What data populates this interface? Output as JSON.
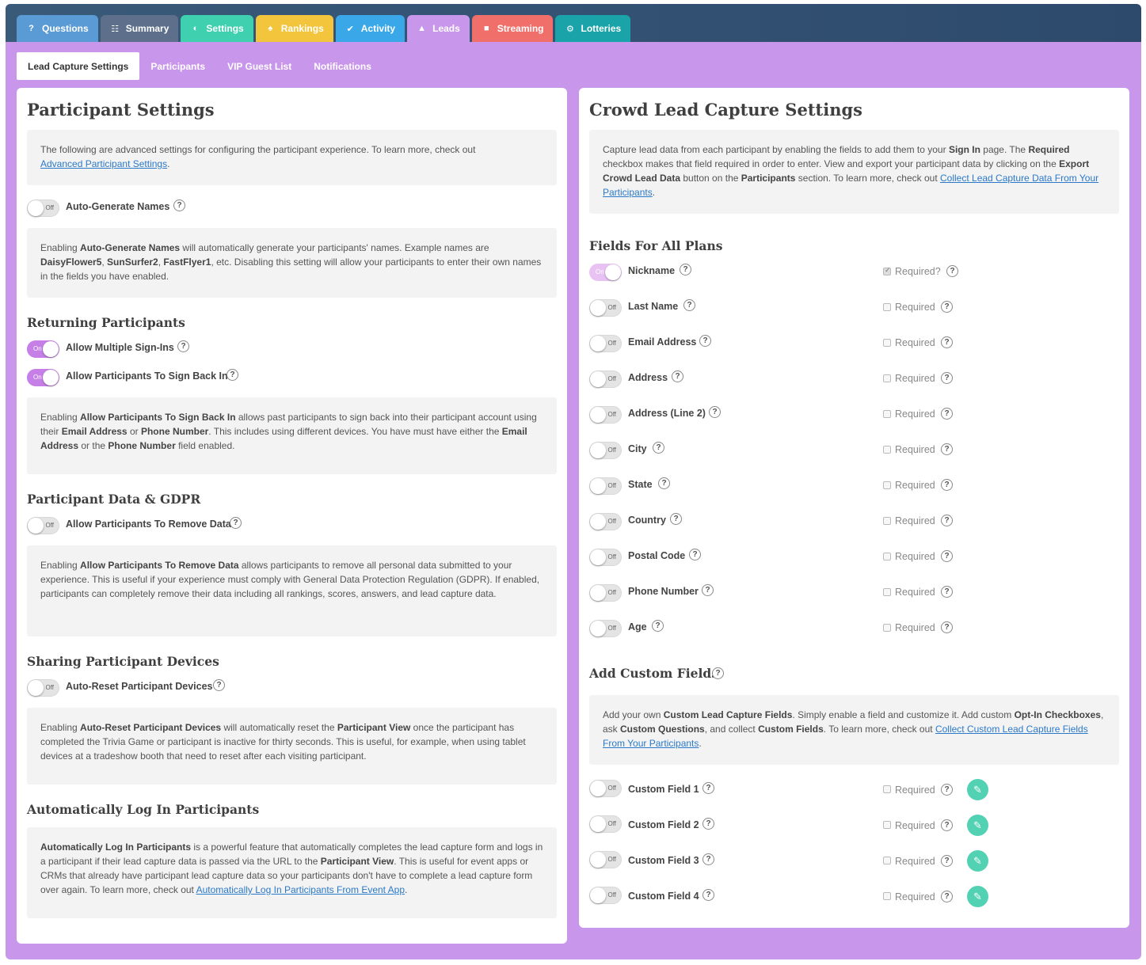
{
  "tabs": [
    {
      "label": "Questions",
      "icon": "question-icon",
      "color": "#5b9bd5"
    },
    {
      "label": "Summary",
      "icon": "list-icon",
      "color": "#5d6f8a"
    },
    {
      "label": "Settings",
      "icon": "toggle-icon",
      "color": "#3fd0b0"
    },
    {
      "label": "Rankings",
      "icon": "trophy-icon",
      "color": "#f2c53d"
    },
    {
      "label": "Activity",
      "icon": "check-circle-icon",
      "color": "#3aa8e8"
    },
    {
      "label": "Leads",
      "icon": "user-icon",
      "color": "#c896ea"
    },
    {
      "label": "Streaming",
      "icon": "video-icon",
      "color": "#f06f6a"
    },
    {
      "label": "Lotteries",
      "icon": "gear-icon",
      "color": "#1aa3a8"
    }
  ],
  "subtabs": [
    "Lead Capture Settings",
    "Participants",
    "VIP Guest List",
    "Notifications"
  ],
  "left": {
    "title": "Participant Settings",
    "intro": {
      "text": "The following are advanced settings for configuring the participant experience. To learn more, check out",
      "link": "Advanced Participant Settings"
    },
    "auto_generate": {
      "label": "Auto-Generate Names",
      "state": "Off"
    },
    "auto_generate_note": {
      "p1": "Enabling ",
      "b1": "Auto-Generate Names",
      "p2": " will automatically generate your participants' names. Example names are ",
      "b2": "DaisyFlower5",
      "p3": ", ",
      "b3": "SunSurfer2",
      "p4": ", ",
      "b4": "FastFlyer1",
      "p5": ", etc. Disabling this setting will allow your participants to enter their own names in the fields you have enabled."
    },
    "returning_title": "Returning Participants",
    "multiple_signins": {
      "label": "Allow Multiple Sign-Ins",
      "state": "On"
    },
    "sign_back_in": {
      "label": "Allow Participants To Sign Back In",
      "state": "On"
    },
    "sign_back_note": {
      "p1": "Enabling ",
      "b1": "Allow Participants To Sign Back In",
      "p2": " allows past participants to sign back into their participant account using their ",
      "b2": "Email Address",
      "p3": " or ",
      "b3": "Phone Number",
      "p4": ". This includes using different devices. You have must have either the ",
      "b4": "Email Address",
      "p5": " or the ",
      "b5": "Phone Number",
      "p6": " field enabled."
    },
    "gdpr_title": "Participant Data & GDPR",
    "remove_data": {
      "label": "Allow Participants To Remove Data",
      "state": "Off"
    },
    "remove_note": {
      "p1": "Enabling ",
      "b1": "Allow Participants To Remove Data",
      "p2": " allows participants to remove all personal data submitted to your experience. This is useful if your experience must comply with General Data Protection Regulation (GDPR). If enabled, participants can completely remove their data including all rankings, scores, answers, and lead capture data."
    },
    "sharing_title": "Sharing Participant Devices",
    "auto_reset": {
      "label": "Auto-Reset Participant Devices",
      "state": "Off"
    },
    "reset_note": {
      "p1": "Enabling ",
      "b1": "Auto-Reset Participant Devices",
      "p2": " will automatically reset the ",
      "b2": "Participant View",
      "p3": " once the participant has completed the Trivia Game or participant is inactive for thirty seconds. This is useful, for example, when using tablet devices at a tradeshow booth that need to reset after each visiting participant."
    },
    "autolog_title": "Automatically Log In Participants",
    "autolog_note": {
      "b1": "Automatically Log In Participants",
      "p1": " is a powerful feature that automatically completes the lead capture form and logs in a participant if their lead capture data is passed via the URL to the ",
      "b2": "Participant View",
      "p2": ". This is useful for event apps or CRMs that already have participant lead capture data so your participants don't have to complete a lead capture form over again. To learn more, check out ",
      "link": "Automatically Log In Participants From Event App"
    }
  },
  "right": {
    "title": "Crowd Lead Capture Settings",
    "intro": {
      "p1": "Capture lead data from each participant by enabling the fields to add them to your ",
      "b1": "Sign In",
      "p2": " page. The ",
      "b2": "Required",
      "p3": " checkbox makes that field required in order to enter. View and export your participant data by clicking on the ",
      "b3": "Export Crowd Lead Data",
      "p4": " button on the ",
      "b4": "Participants",
      "p5": " section. To learn more, check out ",
      "link": "Collect Lead Capture Data From Your Participants"
    },
    "fields_title": "Fields For All Plans",
    "fields": [
      {
        "label": "Nickname",
        "state": "On",
        "required": "Required?",
        "checked": true
      },
      {
        "label": "Last Name",
        "state": "Off",
        "required": "Required",
        "checked": false
      },
      {
        "label": "Email Address",
        "state": "Off",
        "required": "Required",
        "checked": false
      },
      {
        "label": "Address",
        "state": "Off",
        "required": "Required",
        "checked": false
      },
      {
        "label": "Address (Line 2)",
        "state": "Off",
        "required": "Required",
        "checked": false
      },
      {
        "label": "City",
        "state": "Off",
        "required": "Required",
        "checked": false
      },
      {
        "label": "State",
        "state": "Off",
        "required": "Required",
        "checked": false
      },
      {
        "label": "Country",
        "state": "Off",
        "required": "Required",
        "checked": false
      },
      {
        "label": "Postal Code",
        "state": "Off",
        "required": "Required",
        "checked": false
      },
      {
        "label": "Phone Number",
        "state": "Off",
        "required": "Required",
        "checked": false
      },
      {
        "label": "Age",
        "state": "Off",
        "required": "Required",
        "checked": false
      }
    ],
    "custom_title": "Add Custom Fields",
    "custom_intro": {
      "p1": "Add your own ",
      "b1": "Custom Lead Capture Fields",
      "p2": ". Simply enable a field and customize it. Add custom ",
      "b2": "Opt-In Checkboxes",
      "p3": ", ask ",
      "b3": "Custom Questions",
      "p4": ", and collect ",
      "b4": "Custom Fields",
      "p5": ". To learn more, check out ",
      "link": "Collect Custom Lead Capture Fields From Your Participants"
    },
    "custom_fields": [
      {
        "label": "Custom Field 1",
        "state": "Off",
        "required": "Required"
      },
      {
        "label": "Custom Field 2",
        "state": "Off",
        "required": "Required"
      },
      {
        "label": "Custom Field 3",
        "state": "Off",
        "required": "Required"
      },
      {
        "label": "Custom Field 4",
        "state": "Off",
        "required": "Required"
      }
    ]
  },
  "help_glyph": "?",
  "colors": {
    "accent": "#c896ea",
    "toggle_on": "#c57fe6",
    "edit": "#52d1b3",
    "link": "#2b79c8"
  }
}
